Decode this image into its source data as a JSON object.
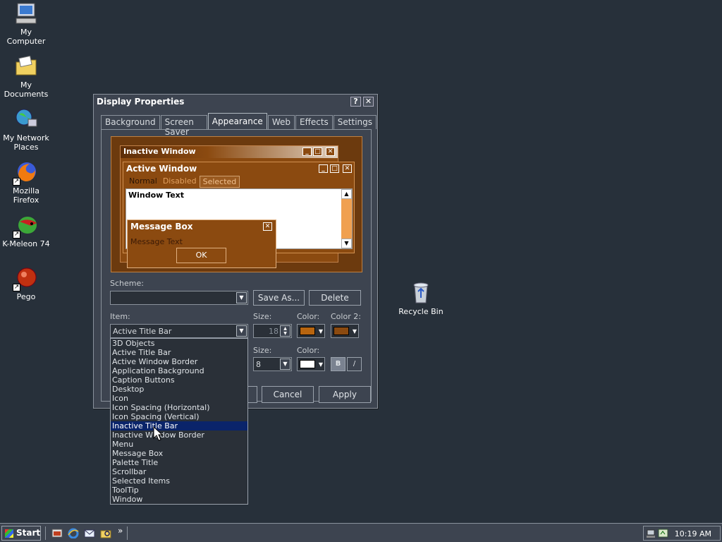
{
  "desktop": {
    "icons": [
      {
        "label": "My Computer"
      },
      {
        "label": "My Documents"
      },
      {
        "label": "My Network\nPlaces"
      },
      {
        "label": "Mozilla Firefox"
      },
      {
        "label": "K-Meleon 74"
      },
      {
        "label": "Pego"
      },
      {
        "label": "Recycle Bin"
      }
    ]
  },
  "dialog": {
    "title": "Display Properties",
    "help_glyph": "?",
    "close_glyph": "✕",
    "tabs": [
      {
        "label": "Background"
      },
      {
        "label": "Screen Saver"
      },
      {
        "label": "Appearance",
        "active": true
      },
      {
        "label": "Web"
      },
      {
        "label": "Effects"
      },
      {
        "label": "Settings"
      }
    ],
    "preview": {
      "inactive_title": "Inactive Window",
      "active_title": "Active Window",
      "menu_normal": "Normal",
      "menu_disabled": "Disabled",
      "menu_selected": "Selected",
      "window_text": "Window Text",
      "msgbox_title": "Message Box",
      "msgbox_text": "Message Text",
      "msgbox_ok": "OK"
    },
    "scheme": {
      "label": "Scheme:",
      "value": "",
      "save_as": "Save As...",
      "delete": "Delete"
    },
    "item": {
      "label": "Item:",
      "value": "Active Title Bar",
      "size_label": "Size:",
      "size_value": "18",
      "color_label": "Color:",
      "color2_label": "Color 2:",
      "color1": "#b8650f",
      "color2": "#8b4a10"
    },
    "font": {
      "size_label": "Size:",
      "size_value": "8",
      "color_label": "Color:",
      "color": "#ffffff",
      "bold_label": "B",
      "italic_label": "/"
    },
    "buttons": {
      "cancel": "Cancel",
      "apply": "Apply"
    },
    "item_list": [
      "3D Objects",
      "Active Title Bar",
      "Active Window Border",
      "Application Background",
      "Caption Buttons",
      "Desktop",
      "Icon",
      "Icon Spacing (Horizontal)",
      "Icon Spacing (Vertical)",
      "Inactive Title Bar",
      "Inactive Window Border",
      "Menu",
      "Message Box",
      "Palette Title",
      "Scrollbar",
      "Selected Items",
      "ToolTip",
      "Window"
    ],
    "item_list_selected": "Inactive Title Bar"
  },
  "taskbar": {
    "start_label": "Start",
    "quicklaunch_more": "»",
    "clock": "10:19 AM"
  },
  "colors": {
    "desktop_bg": "#27303a",
    "window_bg": "#3d4450",
    "selection": "#0a246a",
    "preview_brown": "#8b4a10"
  }
}
